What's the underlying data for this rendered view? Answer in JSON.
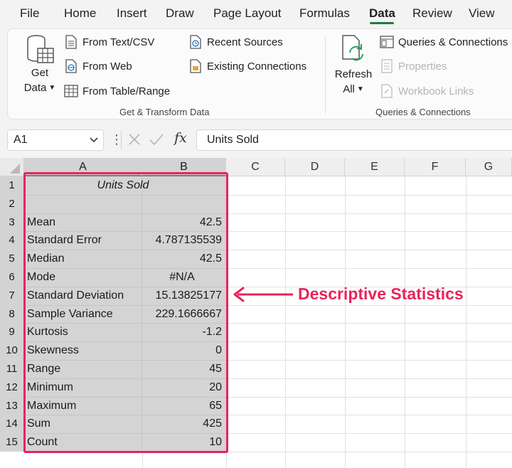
{
  "menu": {
    "tabs": [
      "File",
      "Home",
      "Insert",
      "Draw",
      "Page Layout",
      "Formulas",
      "Data",
      "Review",
      "View"
    ],
    "active_tab": "Data"
  },
  "ribbon": {
    "get_data": {
      "line1": "Get",
      "line2": "Data"
    },
    "from_text_csv": "From Text/CSV",
    "from_web": "From Web",
    "from_table_range": "From Table/Range",
    "recent_sources": "Recent Sources",
    "existing_connections": "Existing Connections",
    "group_get_transform": "Get & Transform Data",
    "refresh_all": {
      "line1": "Refresh",
      "line2": "All"
    },
    "queries_connections": "Queries & Connections",
    "properties": "Properties",
    "workbook_links": "Workbook Links",
    "group_queries_connections": "Queries & Connections"
  },
  "formula_bar": {
    "name_box": "A1",
    "fx": "fx",
    "content": "Units Sold"
  },
  "sheet": {
    "columns": [
      "A",
      "B",
      "C",
      "D",
      "E",
      "F",
      "G"
    ],
    "rows": [
      "1",
      "2",
      "3",
      "4",
      "5",
      "6",
      "7",
      "8",
      "9",
      "10",
      "11",
      "12",
      "13",
      "14",
      "15"
    ],
    "header": "Units Sold",
    "stats": [
      {
        "label": "Mean",
        "value": "42.5"
      },
      {
        "label": "Standard Error",
        "value": "4.787135539"
      },
      {
        "label": "Median",
        "value": "42.5"
      },
      {
        "label": "Mode",
        "value": "#N/A"
      },
      {
        "label": "Standard Deviation",
        "value": "15.13825177"
      },
      {
        "label": "Sample Variance",
        "value": "229.1666667"
      },
      {
        "label": "Kurtosis",
        "value": "-1.2"
      },
      {
        "label": "Skewness",
        "value": "0"
      },
      {
        "label": "Range",
        "value": "45"
      },
      {
        "label": "Minimum",
        "value": "20"
      },
      {
        "label": "Maximum",
        "value": "65"
      },
      {
        "label": "Sum",
        "value": "425"
      },
      {
        "label": "Count",
        "value": "10"
      }
    ]
  },
  "annotation": {
    "text": "Descriptive Statistics"
  },
  "colors": {
    "accent_green": "#1e7a45",
    "highlight_pink": "#e8245a",
    "selection_gray": "#d4d4d4"
  }
}
